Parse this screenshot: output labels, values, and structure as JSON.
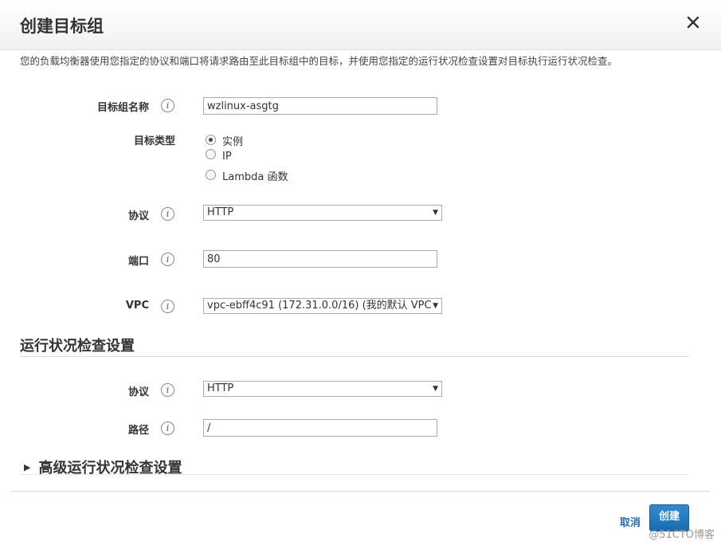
{
  "dialog": {
    "title": "创建目标组",
    "intro": "您的负载均衡器使用您指定的协议和端口将请求路由至此目标组中的目标，并使用您指定的运行状况检查设置对目标执行运行状况检查。"
  },
  "form": {
    "name_label": "目标组名称",
    "name_value": "wzlinux-asgtg",
    "type_label": "目标类型",
    "type_options": [
      "实例",
      "IP",
      "Lambda 函数"
    ],
    "type_selected": "实例",
    "protocol_label": "协议",
    "protocol_value": "HTTP",
    "port_label": "端口",
    "port_value": "80",
    "vpc_label": "VPC",
    "vpc_value": "vpc-ebff4c91 (172.31.0.0/16) (我的默认 VPC"
  },
  "health": {
    "section_title": "运行状况检查设置",
    "protocol_label": "协议",
    "protocol_value": "HTTP",
    "path_label": "路径",
    "path_value": "/"
  },
  "advanced": {
    "title": "高级运行状况检查设置"
  },
  "footer": {
    "cancel_label": "取消",
    "create_label": "创建",
    "watermark": "@51CTO博客"
  },
  "icons": {
    "info": "i"
  },
  "colors": {
    "primary_button": "#1a6bb0",
    "link": "#2b6cb0"
  }
}
